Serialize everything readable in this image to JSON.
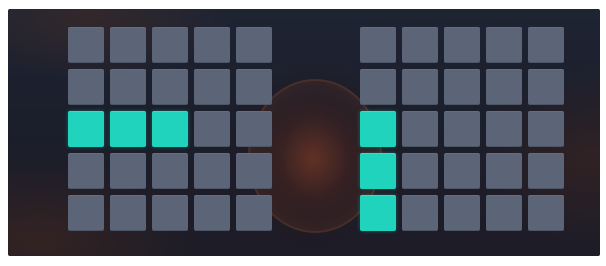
{
  "colors": {
    "tile_default": "#5b6577",
    "tile_active": "#1fd3bd",
    "background": "#1e2230"
  },
  "grids": [
    {
      "name": "left-grid",
      "rows": 5,
      "cols": 5,
      "active": [
        [
          2,
          0
        ],
        [
          2,
          1
        ],
        [
          2,
          2
        ]
      ]
    },
    {
      "name": "right-grid",
      "rows": 5,
      "cols": 5,
      "active": [
        [
          2,
          0
        ],
        [
          3,
          0
        ],
        [
          4,
          0
        ]
      ]
    }
  ]
}
